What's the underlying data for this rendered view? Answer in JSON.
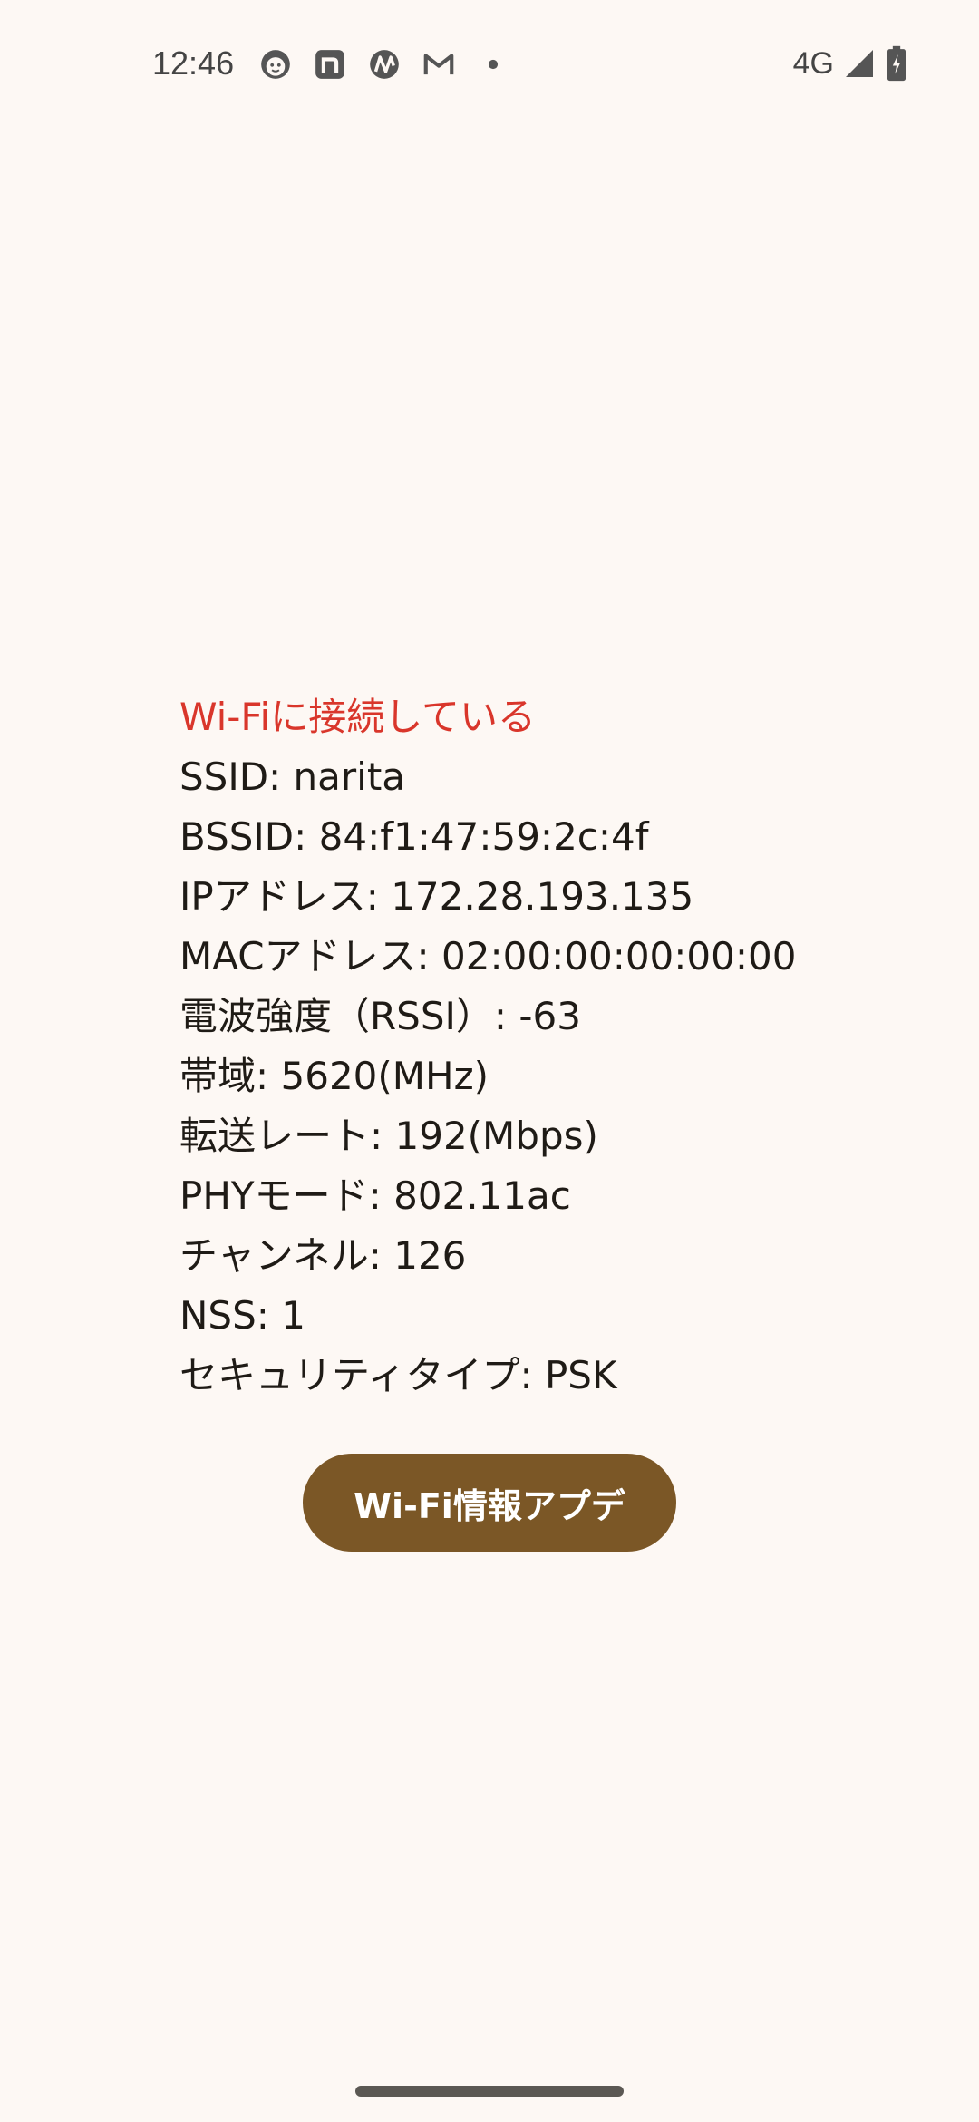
{
  "status_bar": {
    "time": "12:46",
    "network_type": "4G",
    "notification_icons": [
      "cat-face-icon",
      "n-app-icon",
      "nova-icon",
      "gmail-icon",
      "more-dot-icon"
    ],
    "system_icons": [
      "signal-icon",
      "battery-charging-icon"
    ]
  },
  "wifi_info": {
    "connection_status": "Wi-Fiに接続している",
    "lines": [
      "SSID: narita",
      "BSSID: 84:f1:47:59:2c:4f",
      "IPアドレス: 172.28.193.135",
      "MACアドレス: 02:00:00:00:00:00",
      "電波強度（RSSI）: -63",
      "帯域: 5620(MHz)",
      "転送レート: 192(Mbps)",
      "PHYモード: 802.11ac",
      "チャンネル: 126",
      "NSS: 1",
      "セキュリティタイプ: PSK"
    ]
  },
  "actions": {
    "update_label": "Wi-Fi情報アプデ"
  },
  "colors": {
    "background": "#fdf8f4",
    "status_text": "#d9362b",
    "button_bg": "#7b5726",
    "button_text": "#ffffff"
  }
}
